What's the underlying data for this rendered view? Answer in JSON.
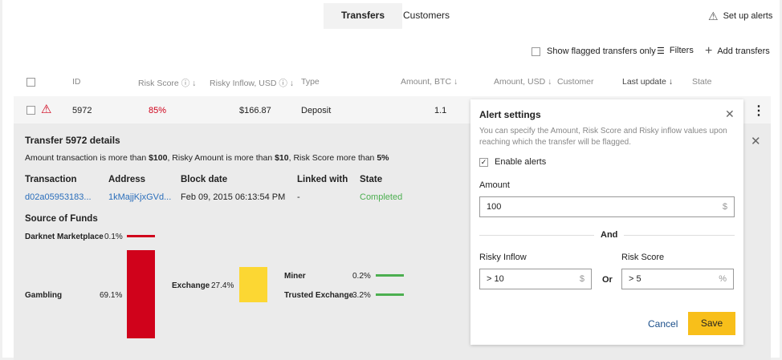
{
  "tabs": [
    "Transfers",
    "Customers"
  ],
  "setup_alerts": "Set up alerts",
  "toolbar": {
    "flagged": "Show flagged transfers only",
    "filters": "Filters",
    "add": "Add transfers"
  },
  "columns": {
    "id": "ID",
    "risk": "Risk Score",
    "inflow": "Risky Inflow, USD",
    "type": "Type",
    "btc": "Amount, BTC",
    "usd": "Amount, USD",
    "customer": "Customer",
    "last": "Last update",
    "state": "State"
  },
  "row": {
    "id": "5972",
    "risk": "85%",
    "inflow": "$166.87",
    "type": "Deposit",
    "btc": "1.1"
  },
  "details": {
    "title": "Transfer 5972 details",
    "msg_pre": "Amount transaction is more than ",
    "v1": "$100",
    "msg_mid1": ", Risky Amount is more than ",
    "v2": "$10",
    "msg_mid2": ", Risk Score more than ",
    "v3": "5%",
    "headers": [
      "Transaction",
      "Address",
      "Block date",
      "Linked with",
      "State"
    ],
    "values": [
      "d02a05953183...",
      "1kMajjKjxGVd...",
      "Feb 09, 2015 06:13:54 PM",
      "-",
      "Completed"
    ],
    "sof_title": "Source of Funds",
    "sources": [
      {
        "name": "Darknet Marketplace",
        "pct": "0.1%"
      },
      {
        "name": "Gambling",
        "pct": "69.1%"
      },
      {
        "name": "Exchange",
        "pct": "27.4%"
      },
      {
        "name": "Miner",
        "pct": "0.2%"
      },
      {
        "name": "Trusted Exchange",
        "pct": "3.2%"
      }
    ]
  },
  "alert": {
    "title": "Alert settings",
    "desc": "You can specify the Amount, Risk Score and Risky inflow values upon reaching which the transfer will be flagged.",
    "enable": "Enable alerts",
    "amount_label": "Amount",
    "amount": "100",
    "amount_unit": "$",
    "and": "And",
    "inflow_label": "Risky Inflow",
    "inflow": "> 10",
    "inflow_unit": "$",
    "or": "Or",
    "risk_label": "Risk Score",
    "risk": "> 5",
    "risk_unit": "%",
    "cancel": "Cancel",
    "save": "Save"
  },
  "colors": {
    "red": "#d0021b",
    "yellow": "#fcd733",
    "green": "#4caf50",
    "link": "#2a6ebb",
    "save": "#f8bf1a"
  }
}
